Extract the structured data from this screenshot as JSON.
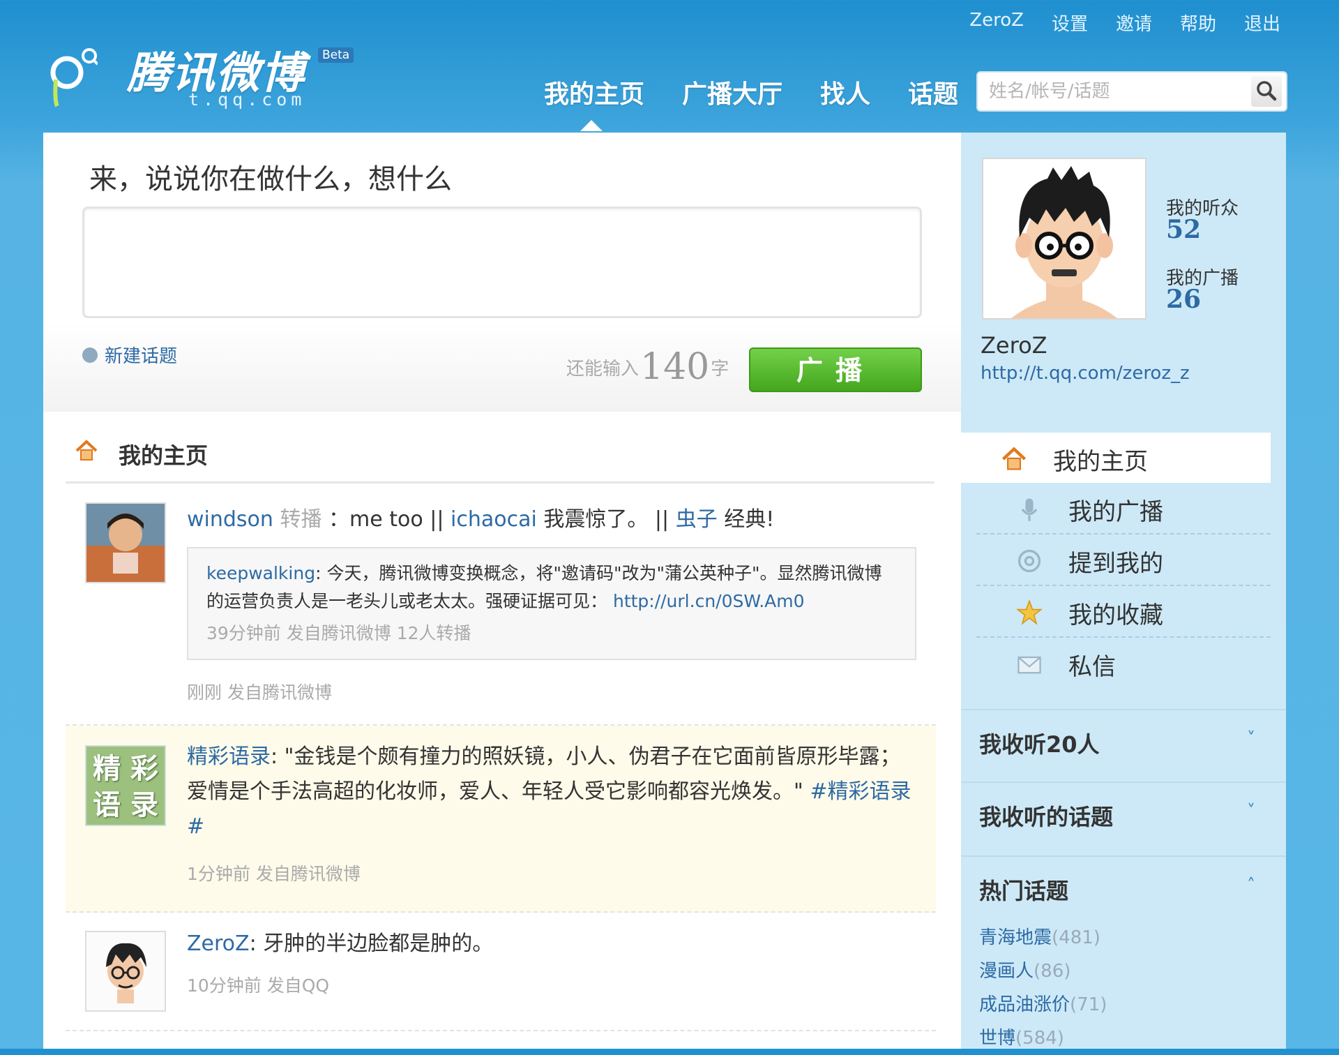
{
  "top_links": [
    "ZeroZ",
    "设置",
    "邀请",
    "帮助",
    "退出"
  ],
  "logo": {
    "title": "腾讯微博",
    "beta": "Beta",
    "url": "t.qq.com"
  },
  "main_nav": [
    "我的主页",
    "广播大厅",
    "找人",
    "话题"
  ],
  "search": {
    "placeholder": "姓名/帐号/话题",
    "icon": "search-icon"
  },
  "composer": {
    "prompt": "来，说说你在做什么，想什么",
    "new_topic": "新建话题",
    "counter_prefix": "还能输入",
    "counter_value": "140",
    "counter_suffix": "字",
    "submit_label": "广播"
  },
  "section_title": "我的主页",
  "feed": [
    {
      "author": "windson",
      "action": "转播",
      "text_1": "：me too ||",
      "mention_1": "ichaocai",
      "text_2": "我震惊了。 ||",
      "mention_2": "虫子",
      "text_3": "经典!",
      "quote": {
        "author": "keepwalking",
        "text": ": 今天，腾讯微博变换概念，将\"邀请码\"改为\"蒲公英种子\"。显然腾讯微博的运营负责人是一老头儿或老太太。强硬证据可见：",
        "link": "http://url.cn/0SW.Am0",
        "meta": "39分钟前 发自腾讯微博 12人转播"
      },
      "meta": "刚刚 发自腾讯微博"
    },
    {
      "author": "精彩语录",
      "avatar_text_1": "精 彩",
      "avatar_text_2": "语 录",
      "text": ": \"金钱是个颇有撞力的照妖镜，小人、伪君子在它面前皆原形毕露；爱情是个手法高超的化妆师，爱人、年轻人受它影响都容光焕发。\"",
      "tag": "#精彩语录#",
      "meta": "1分钟前 发自腾讯微博"
    },
    {
      "author": "ZeroZ",
      "text": ": 牙肿的半边脸都是肿的。",
      "meta": "10分钟前 发自QQ"
    }
  ],
  "profile": {
    "listeners_label": "我的听众",
    "listeners": "52",
    "broadcasts_label": "我的广播",
    "broadcasts": "26",
    "name": "ZeroZ",
    "url": "http://t.qq.com/zeroz_z"
  },
  "side_nav": [
    {
      "label": "我的主页",
      "icon": "home-icon"
    },
    {
      "label": "我的广播",
      "icon": "microphone-icon"
    },
    {
      "label": "提到我的",
      "icon": "at-icon"
    },
    {
      "label": "我的收藏",
      "icon": "star-icon"
    },
    {
      "label": "私信",
      "icon": "mail-icon"
    }
  ],
  "following": {
    "label": "我收听20人",
    "chevron": "˅"
  },
  "topics_followed": {
    "label": "我收听的话题",
    "chevron": "˅"
  },
  "hot_topics": {
    "label": "热门话题",
    "chevron": "˄",
    "items": [
      {
        "name": "青海地震",
        "count": "(481)"
      },
      {
        "name": "漫画人",
        "count": "(86)"
      },
      {
        "name": "成品油涨价",
        "count": "(71)"
      },
      {
        "name": "世博",
        "count": "(584)"
      }
    ]
  },
  "colors": {
    "accent": "#2d6aa4",
    "button_green": "#4cb024",
    "bg_blue": "#3ea5dc",
    "side_bg": "#cde9f7"
  }
}
